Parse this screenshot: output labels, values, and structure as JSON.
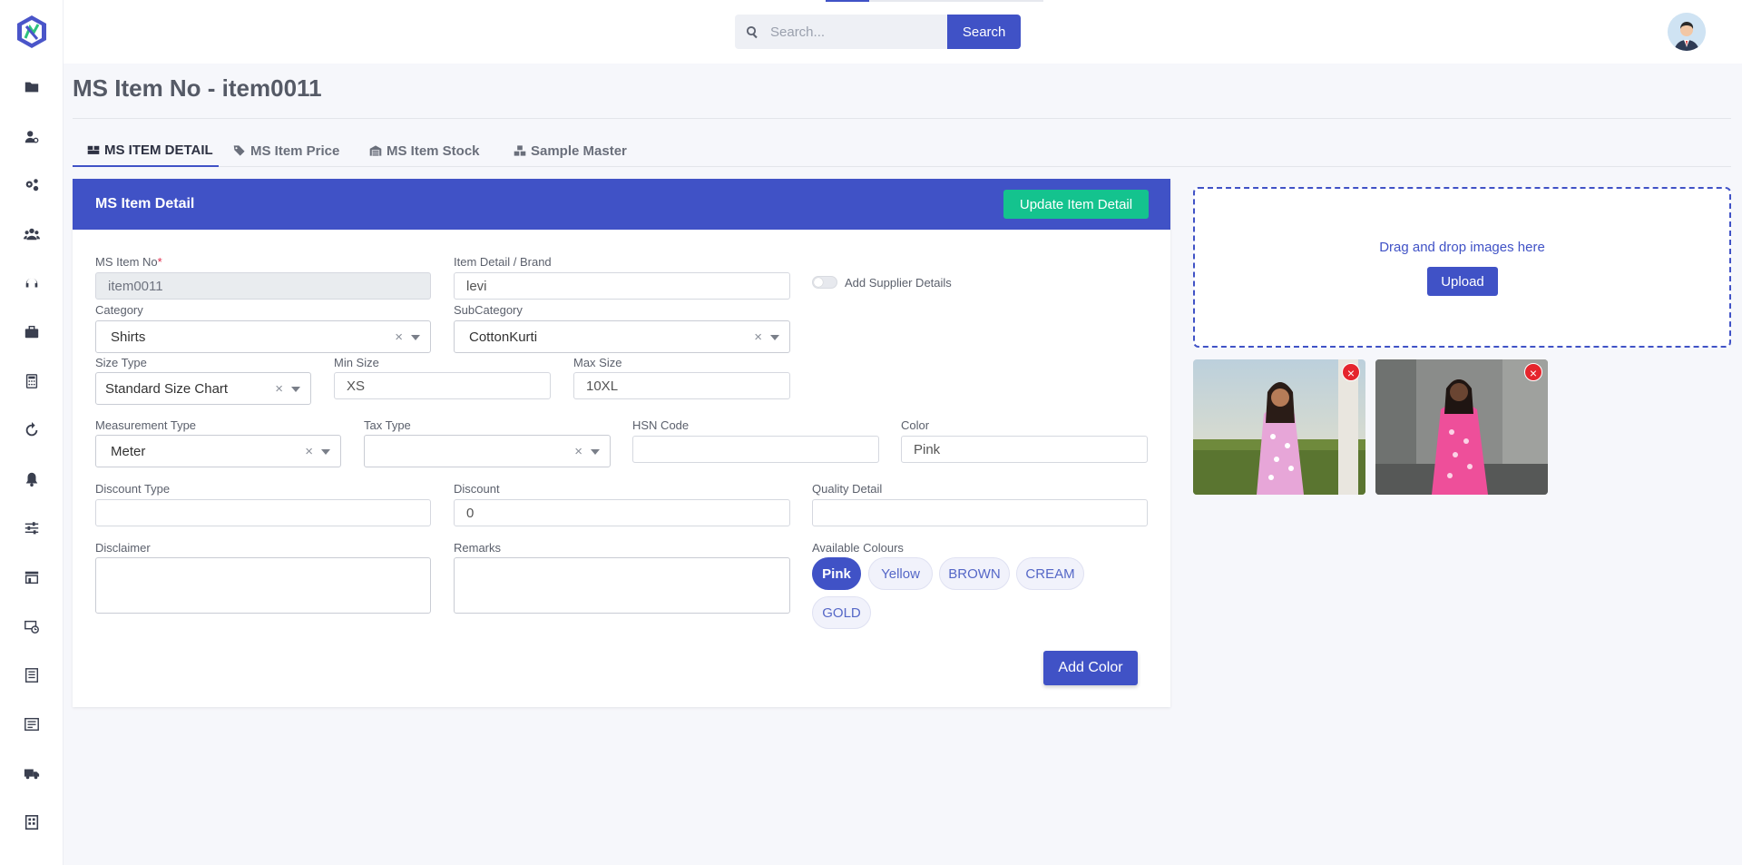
{
  "topbar": {
    "search_placeholder": "Search...",
    "search_button": "Search"
  },
  "sidebar": {
    "icons": [
      "folder-icon",
      "user-settings-icon",
      "gears-icon",
      "users-icon",
      "headset-icon",
      "briefcase-icon",
      "calculator-icon",
      "refresh-icon",
      "bell-icon",
      "sliders-icon",
      "store-icon",
      "money-cycle-icon",
      "report-icon",
      "list-icon",
      "truck-icon",
      "building-icon"
    ]
  },
  "page": {
    "title": "MS Item No - item0011"
  },
  "tabs": [
    {
      "label": "MS ITEM DETAIL",
      "icon": "boxes-icon",
      "active": true
    },
    {
      "label": "MS Item Price",
      "icon": "tags-icon",
      "active": false
    },
    {
      "label": "MS Item Stock",
      "icon": "warehouse-icon",
      "active": false
    },
    {
      "label": "Sample Master",
      "icon": "cubes-icon",
      "active": false
    }
  ],
  "card": {
    "title": "MS Item Detail",
    "update_button": "Update Item Detail"
  },
  "form": {
    "ms_item_no": {
      "label": "MS Item No",
      "required_mark": "*",
      "value": "item0011"
    },
    "brand": {
      "label": "Item Detail / Brand",
      "value": "levi"
    },
    "supplier_toggle": {
      "label": "Add Supplier Details",
      "on": false
    },
    "category": {
      "label": "Category",
      "value": "Shirts"
    },
    "subcategory": {
      "label": "SubCategory",
      "value": "CottonKurti"
    },
    "size_type": {
      "label": "Size Type",
      "value": "Standard Size Chart"
    },
    "min_size": {
      "label": "Min Size",
      "value": "XS"
    },
    "max_size": {
      "label": "Max Size",
      "value": "10XL"
    },
    "measurement_type": {
      "label": "Measurement Type",
      "value": "Meter"
    },
    "tax_type": {
      "label": "Tax Type",
      "value": ""
    },
    "hsn_code": {
      "label": "HSN Code",
      "value": ""
    },
    "color": {
      "label": "Color",
      "value": "Pink"
    },
    "discount_type": {
      "label": "Discount Type",
      "value": ""
    },
    "discount": {
      "label": "Discount",
      "value": "0"
    },
    "quality_detail": {
      "label": "Quality Detail",
      "value": ""
    },
    "disclaimer": {
      "label": "Disclaimer",
      "value": ""
    },
    "remarks": {
      "label": "Remarks",
      "value": ""
    },
    "available_colours": {
      "label": "Available Colours",
      "chips": [
        {
          "label": "Pink",
          "active": true
        },
        {
          "label": "Yellow",
          "active": false
        },
        {
          "label": "BROWN",
          "active": false
        },
        {
          "label": "CREAM",
          "active": false
        },
        {
          "label": "GOLD",
          "active": false
        }
      ]
    },
    "clear_glyph": "×",
    "add_color_button": "Add Color"
  },
  "uploader": {
    "drop_text": "Drag and drop images here",
    "upload_button": "Upload",
    "remove_glyph": "×",
    "images": [
      "pink-kurti-field-photo",
      "pink-kurti-wall-photo"
    ]
  },
  "colors": {
    "primary": "#4052c6",
    "success": "#14c38e",
    "danger": "#e5252d"
  }
}
